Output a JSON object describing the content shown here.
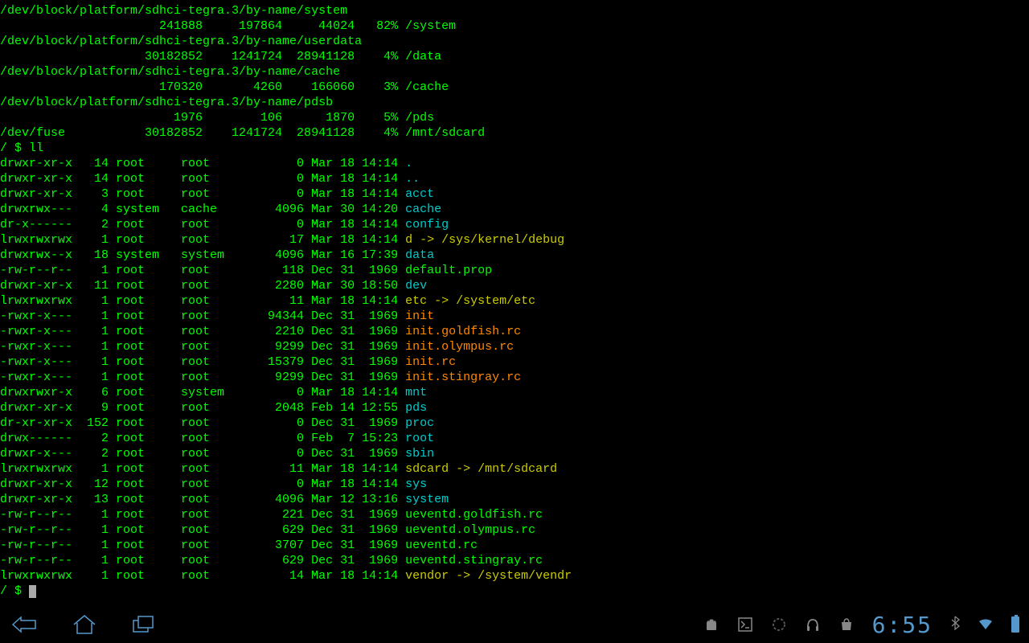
{
  "df": [
    {
      "dev": "/dev/block/platform/sdhci-tegra.3/by-name/system",
      "total": "241888",
      "used": "197864",
      "free": "44024",
      "pct": "82%",
      "mount": "/system"
    },
    {
      "dev": "/dev/block/platform/sdhci-tegra.3/by-name/userdata",
      "total": "30182852",
      "used": "1241724",
      "free": "28941128",
      "pct": "4%",
      "mount": "/data"
    },
    {
      "dev": "/dev/block/platform/sdhci-tegra.3/by-name/cache",
      "total": "170320",
      "used": "4260",
      "free": "166060",
      "pct": "3%",
      "mount": "/cache"
    },
    {
      "dev": "/dev/block/platform/sdhci-tegra.3/by-name/pdsb",
      "total": "1976",
      "used": "106",
      "free": "1870",
      "pct": "5%",
      "mount": "/pds"
    },
    {
      "dev": "/dev/fuse",
      "total": "30182852",
      "used": "1241724",
      "free": "28941128",
      "pct": "4%",
      "mount": "/mnt/sdcard",
      "inline": true
    }
  ],
  "prompt1": "/ $ ll",
  "prompt2": "/ $ ",
  "ll": [
    {
      "perm": "drwxr-xr-x",
      "n": "14",
      "u": "root",
      "g": "root",
      "sz": "0",
      "date": "Mar 18 14:14",
      "name": ".",
      "type": "dir"
    },
    {
      "perm": "drwxr-xr-x",
      "n": "14",
      "u": "root",
      "g": "root",
      "sz": "0",
      "date": "Mar 18 14:14",
      "name": "..",
      "type": "dir"
    },
    {
      "perm": "drwxr-xr-x",
      "n": "3",
      "u": "root",
      "g": "root",
      "sz": "0",
      "date": "Mar 18 14:14",
      "name": "acct",
      "type": "dir"
    },
    {
      "perm": "drwxrwx---",
      "n": "4",
      "u": "system",
      "g": "cache",
      "sz": "4096",
      "date": "Mar 30 14:20",
      "name": "cache",
      "type": "dir"
    },
    {
      "perm": "dr-x------",
      "n": "2",
      "u": "root",
      "g": "root",
      "sz": "0",
      "date": "Mar 18 14:14",
      "name": "config",
      "type": "dir"
    },
    {
      "perm": "lrwxrwxrwx",
      "n": "1",
      "u": "root",
      "g": "root",
      "sz": "17",
      "date": "Mar 18 14:14",
      "name": "d -> /sys/kernel/debug",
      "type": "link"
    },
    {
      "perm": "drwxrwx--x",
      "n": "18",
      "u": "system",
      "g": "system",
      "sz": "4096",
      "date": "Mar 16 17:39",
      "name": "data",
      "type": "dir"
    },
    {
      "perm": "-rw-r--r--",
      "n": "1",
      "u": "root",
      "g": "root",
      "sz": "118",
      "date": "Dec 31  1969",
      "name": "default.prop",
      "type": "file"
    },
    {
      "perm": "drwxr-xr-x",
      "n": "11",
      "u": "root",
      "g": "root",
      "sz": "2280",
      "date": "Mar 30 18:50",
      "name": "dev",
      "type": "dir"
    },
    {
      "perm": "lrwxrwxrwx",
      "n": "1",
      "u": "root",
      "g": "root",
      "sz": "11",
      "date": "Mar 18 14:14",
      "name": "etc -> /system/etc",
      "type": "link"
    },
    {
      "perm": "-rwxr-x---",
      "n": "1",
      "u": "root",
      "g": "root",
      "sz": "94344",
      "date": "Dec 31  1969",
      "name": "init",
      "type": "exec"
    },
    {
      "perm": "-rwxr-x---",
      "n": "1",
      "u": "root",
      "g": "root",
      "sz": "2210",
      "date": "Dec 31  1969",
      "name": "init.goldfish.rc",
      "type": "exec"
    },
    {
      "perm": "-rwxr-x---",
      "n": "1",
      "u": "root",
      "g": "root",
      "sz": "9299",
      "date": "Dec 31  1969",
      "name": "init.olympus.rc",
      "type": "exec"
    },
    {
      "perm": "-rwxr-x---",
      "n": "1",
      "u": "root",
      "g": "root",
      "sz": "15379",
      "date": "Dec 31  1969",
      "name": "init.rc",
      "type": "exec"
    },
    {
      "perm": "-rwxr-x---",
      "n": "1",
      "u": "root",
      "g": "root",
      "sz": "9299",
      "date": "Dec 31  1969",
      "name": "init.stingray.rc",
      "type": "exec"
    },
    {
      "perm": "drwxrwxr-x",
      "n": "6",
      "u": "root",
      "g": "system",
      "sz": "0",
      "date": "Mar 18 14:14",
      "name": "mnt",
      "type": "dir"
    },
    {
      "perm": "drwxr-xr-x",
      "n": "9",
      "u": "root",
      "g": "root",
      "sz": "2048",
      "date": "Feb 14 12:55",
      "name": "pds",
      "type": "dir"
    },
    {
      "perm": "dr-xr-xr-x",
      "n": "152",
      "u": "root",
      "g": "root",
      "sz": "0",
      "date": "Dec 31  1969",
      "name": "proc",
      "type": "dir"
    },
    {
      "perm": "drwx------",
      "n": "2",
      "u": "root",
      "g": "root",
      "sz": "0",
      "date": "Feb  7 15:23",
      "name": "root",
      "type": "dir"
    },
    {
      "perm": "drwxr-x---",
      "n": "2",
      "u": "root",
      "g": "root",
      "sz": "0",
      "date": "Dec 31  1969",
      "name": "sbin",
      "type": "dir"
    },
    {
      "perm": "lrwxrwxrwx",
      "n": "1",
      "u": "root",
      "g": "root",
      "sz": "11",
      "date": "Mar 18 14:14",
      "name": "sdcard -> /mnt/sdcard",
      "type": "link"
    },
    {
      "perm": "drwxr-xr-x",
      "n": "12",
      "u": "root",
      "g": "root",
      "sz": "0",
      "date": "Mar 18 14:14",
      "name": "sys",
      "type": "dir"
    },
    {
      "perm": "drwxr-xr-x",
      "n": "13",
      "u": "root",
      "g": "root",
      "sz": "4096",
      "date": "Mar 12 13:16",
      "name": "system",
      "type": "dir"
    },
    {
      "perm": "-rw-r--r--",
      "n": "1",
      "u": "root",
      "g": "root",
      "sz": "221",
      "date": "Dec 31  1969",
      "name": "ueventd.goldfish.rc",
      "type": "file"
    },
    {
      "perm": "-rw-r--r--",
      "n": "1",
      "u": "root",
      "g": "root",
      "sz": "629",
      "date": "Dec 31  1969",
      "name": "ueventd.olympus.rc",
      "type": "file"
    },
    {
      "perm": "-rw-r--r--",
      "n": "1",
      "u": "root",
      "g": "root",
      "sz": "3707",
      "date": "Dec 31  1969",
      "name": "ueventd.rc",
      "type": "file"
    },
    {
      "perm": "-rw-r--r--",
      "n": "1",
      "u": "root",
      "g": "root",
      "sz": "629",
      "date": "Dec 31  1969",
      "name": "ueventd.stingray.rc",
      "type": "file"
    },
    {
      "perm": "lrwxrwxrwx",
      "n": "1",
      "u": "root",
      "g": "root",
      "sz": "14",
      "date": "Mar 18 14:14",
      "name": "vendor -> /system/vendr",
      "type": "link"
    }
  ],
  "colors": {
    "dir": "#00cccc",
    "link": "#cccc00",
    "exec": "#ff8800",
    "file": "#00ff00"
  },
  "statusbar": {
    "time": "6:55"
  }
}
